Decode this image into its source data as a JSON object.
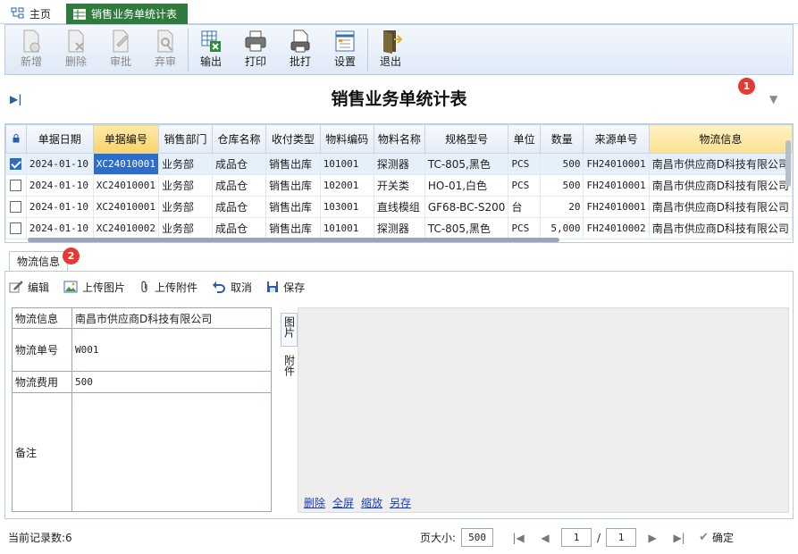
{
  "tabs": {
    "home_label": "主页",
    "active_label": "销售业务单统计表"
  },
  "toolbar": [
    {
      "label": "新增",
      "icon": "new-icon",
      "disabled": true
    },
    {
      "label": "删除",
      "icon": "delete-icon",
      "disabled": true
    },
    {
      "label": "审批",
      "icon": "approve-icon",
      "disabled": true
    },
    {
      "label": "弃审",
      "icon": "unapprove-icon",
      "disabled": true
    },
    {
      "label": "输出",
      "icon": "export-icon",
      "disabled": false
    },
    {
      "label": "打印",
      "icon": "print-icon",
      "disabled": false
    },
    {
      "label": "批打",
      "icon": "batch-print-icon",
      "disabled": false
    },
    {
      "label": "设置",
      "icon": "settings-icon",
      "disabled": false
    },
    {
      "label": "退出",
      "icon": "exit-icon",
      "disabled": false
    }
  ],
  "report": {
    "title": "销售业务单统计表",
    "badge1": "1",
    "badge2": "2"
  },
  "grid": {
    "columns": [
      "单据日期",
      "单据编号",
      "销售部门",
      "仓库名称",
      "收付类型",
      "物料编码",
      "物料名称",
      "规格型号",
      "单位",
      "数量",
      "来源单号",
      "物流信息"
    ],
    "rows": [
      {
        "checked": true,
        "cells": [
          "2024-01-10",
          "XC24010001",
          "业务部",
          "成品仓",
          "销售出库",
          "101001",
          "探测器",
          "TC-805,黑色",
          "PCS",
          "500",
          "FH24010001",
          "南昌市供应商D科技有限公司"
        ]
      },
      {
        "checked": false,
        "cells": [
          "2024-01-10",
          "XC24010001",
          "业务部",
          "成品仓",
          "销售出库",
          "102001",
          "开关类",
          "HO-01,白色",
          "PCS",
          "500",
          "FH24010001",
          "南昌市供应商D科技有限公司"
        ]
      },
      {
        "checked": false,
        "cells": [
          "2024-01-10",
          "XC24010001",
          "业务部",
          "成品仓",
          "销售出库",
          "103001",
          "直线模组",
          "GF68-BC-S200",
          "台",
          "20",
          "FH24010001",
          "南昌市供应商D科技有限公司"
        ]
      },
      {
        "checked": false,
        "cells": [
          "2024-01-10",
          "XC24010002",
          "业务部",
          "成品仓",
          "销售出库",
          "101001",
          "探测器",
          "TC-805,黑色",
          "PCS",
          "5,000",
          "FH24010002",
          "南昌市供应商D科技有限公司"
        ]
      }
    ]
  },
  "detail": {
    "tab_label": "物流信息",
    "actions": [
      {
        "label": "编辑",
        "icon": "edit-icon"
      },
      {
        "label": "上传图片",
        "icon": "upload-image-icon"
      },
      {
        "label": "上传附件",
        "icon": "attachment-icon"
      },
      {
        "label": "取消",
        "icon": "undo-icon"
      },
      {
        "label": "保存",
        "icon": "save-icon"
      }
    ],
    "fields": [
      {
        "label": "物流信息",
        "value": "南昌市供应商D科技有限公司"
      },
      {
        "label": "物流单号",
        "value": "W001"
      },
      {
        "label": "物流费用",
        "value": "500"
      },
      {
        "label": "备注",
        "value": ""
      }
    ],
    "side_tabs": {
      "image": "图片",
      "attachment": "附件"
    },
    "image_links": [
      "删除",
      "全屏",
      "缩放",
      "另存"
    ]
  },
  "status": {
    "record_count_label": "当前记录数:6",
    "page_size_label": "页大小:",
    "page_size": "500",
    "page_current": "1",
    "page_sep": "/",
    "page_total": "1",
    "confirm_label": "确定"
  }
}
